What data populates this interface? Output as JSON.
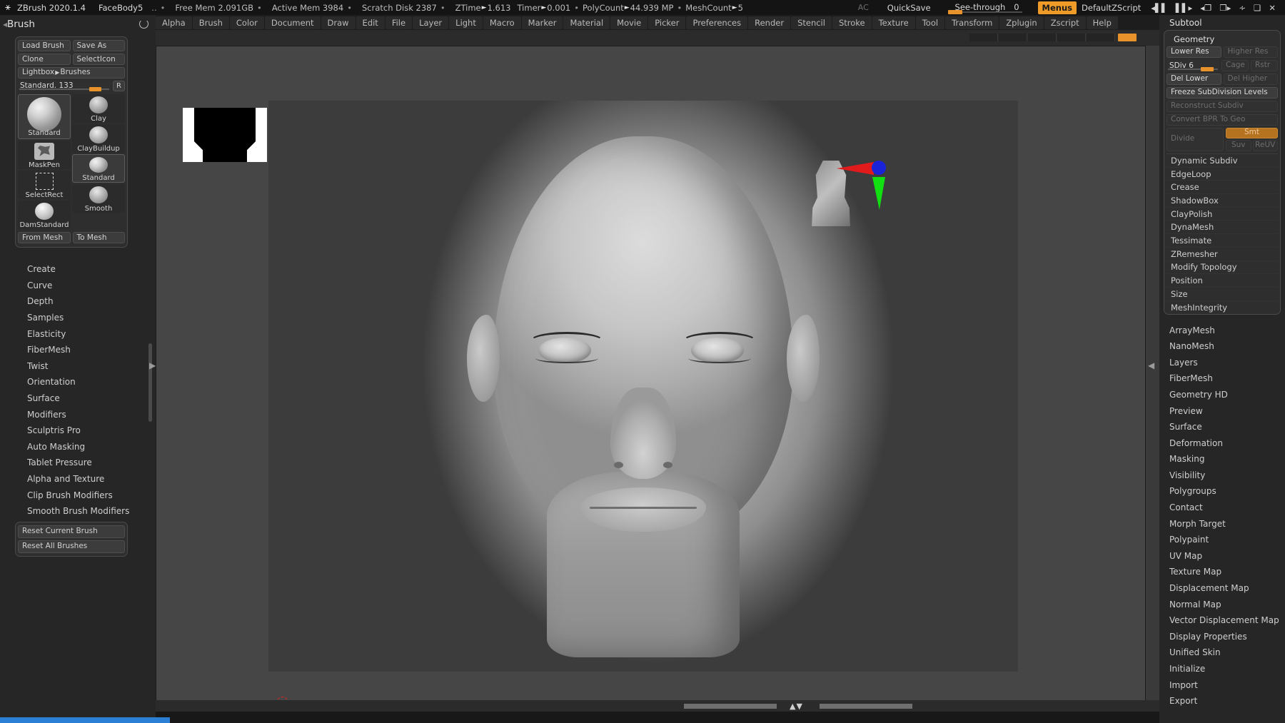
{
  "titlebar": {
    "logo_icon": "zbrush-logo-icon",
    "app_name": "ZBrush 2020.1.4",
    "document_name": "FaceBody5",
    "dots": "..",
    "free_mem": "Free Mem 2.091GB",
    "active_mem": "Active Mem 3984",
    "scratch_disk": "Scratch Disk 2387",
    "ztime_label": "ZTime",
    "ztime_value": "1.613",
    "timer_label": "Timer",
    "timer_value": "0.001",
    "polycount_label": "PolyCount",
    "polycount_value": "44.939 MP",
    "meshcount_label": "MeshCount",
    "meshcount_value": "5",
    "ac": "AC",
    "quicksave": "QuickSave",
    "see_through_label": "See-through",
    "see_through_value": "0",
    "menus": "Menus",
    "zscript": "DefaultZScript",
    "icons": [
      "scroll-left-icon",
      "scroll-right-icon",
      "tray-left-icon",
      "tray-right-icon",
      "minimize-icon",
      "restore-icon",
      "close-icon"
    ]
  },
  "menubar": {
    "items": [
      "Alpha",
      "Brush",
      "Color",
      "Document",
      "Draw",
      "Edit",
      "File",
      "Layer",
      "Light",
      "Macro",
      "Marker",
      "Material",
      "Movie",
      "Picker",
      "Preferences",
      "Render",
      "Stencil",
      "Stroke",
      "Texture",
      "Tool",
      "Transform",
      "Zplugin",
      "Zscript",
      "Help"
    ]
  },
  "brush_palette": {
    "title": "Brush",
    "refresh_icon": "refresh-icon",
    "load_brush": "Load Brush",
    "save_as": "Save As",
    "clone": "Clone",
    "select_icon": "SelectIcon",
    "lightbox": "Lightbox",
    "lightbox_arrow": "▶",
    "lightbox_target": "Brushes",
    "size_label": "Standard.",
    "size_value": "133",
    "r_button": "R",
    "brushes": [
      {
        "name": "Standard",
        "thumb": "standard-brush-thumb",
        "selected": true,
        "size": "big"
      },
      {
        "name": "Clay",
        "thumb": "clay-brush-thumb",
        "selected": false,
        "size": "sm"
      },
      {
        "name": "ClayBuildup",
        "thumb": "claybuildup-brush-thumb",
        "selected": false,
        "size": "sm"
      },
      {
        "name": "MaskPen",
        "thumb": "maskpen-brush-thumb",
        "selected": false,
        "size": "sm"
      },
      {
        "name": "Standard",
        "thumb": "standard-brush-thumb-2",
        "selected": true,
        "size": "sm"
      },
      {
        "name": "SelectRect",
        "thumb": "selectrect-brush-thumb",
        "selected": false,
        "size": "sm"
      },
      {
        "name": "Smooth",
        "thumb": "smooth-brush-thumb",
        "selected": false,
        "size": "sm"
      },
      {
        "name": "DamStandard",
        "thumb": "damstandard-brush-thumb",
        "selected": false,
        "size": "sm"
      }
    ],
    "from_mesh": "From Mesh",
    "to_mesh": "To Mesh",
    "sections": [
      "Create",
      "Curve",
      "Depth",
      "Samples",
      "Elasticity",
      "FiberMesh",
      "Twist",
      "Orientation",
      "Surface",
      "Modifiers",
      "Sculptris Pro",
      "Auto Masking",
      "Tablet Pressure",
      "Alpha and Texture",
      "Clip Brush Modifiers",
      "Smooth Brush Modifiers"
    ],
    "reset_current": "Reset Current Brush",
    "reset_all": "Reset All Brushes"
  },
  "canvas": {
    "alpha_thumb_name": "alpha-preview-thumbnail",
    "model_name": "female-head-sculpt",
    "gizmo_name": "navigation-gizmo"
  },
  "tool_panel": {
    "subtool_title": "Subtool",
    "geometry": {
      "title": "Geometry",
      "lower_res": "Lower Res",
      "higher_res": "Higher Res",
      "sdiv_label": "SDiv",
      "sdiv_value": "6",
      "cage": "Cage",
      "rstr": "Rstr",
      "del_lower": "Del Lower",
      "del_higher": "Del Higher",
      "freeze": "Freeze SubDivision Levels",
      "reconstruct": "Reconstruct Subdiv",
      "convert_bpr": "Convert BPR To Geo",
      "divide": "Divide",
      "smt": "Smt",
      "suv": "Suv",
      "reuv": "ReUV",
      "items": [
        "Dynamic Subdiv",
        "EdgeLoop",
        "Crease",
        "ShadowBox",
        "ClayPolish",
        "DynaMesh",
        "Tessimate",
        "ZRemesher",
        "Modify Topology",
        "Position",
        "Size",
        "MeshIntegrity"
      ]
    },
    "sections": [
      "ArrayMesh",
      "NanoMesh",
      "Layers",
      "FiberMesh",
      "Geometry HD",
      "Preview",
      "Surface",
      "Deformation",
      "Masking",
      "Visibility",
      "Polygroups",
      "Contact",
      "Morph Target",
      "Polypaint",
      "UV Map",
      "Texture Map",
      "Displacement Map",
      "Normal Map",
      "Vector Displacement Map",
      "Display Properties",
      "Unified Skin",
      "Initialize",
      "Import",
      "Export"
    ]
  },
  "colors": {
    "accent_orange": "#e8922b",
    "menus_orange": "#ef9b27",
    "panel_bg": "#262626",
    "canvas_bg": "#464646",
    "gizmo_red": "#e11b1b",
    "gizmo_green": "#11df11",
    "gizmo_blue": "#1a23d8",
    "taskbar_blue": "#2b7fd4"
  }
}
